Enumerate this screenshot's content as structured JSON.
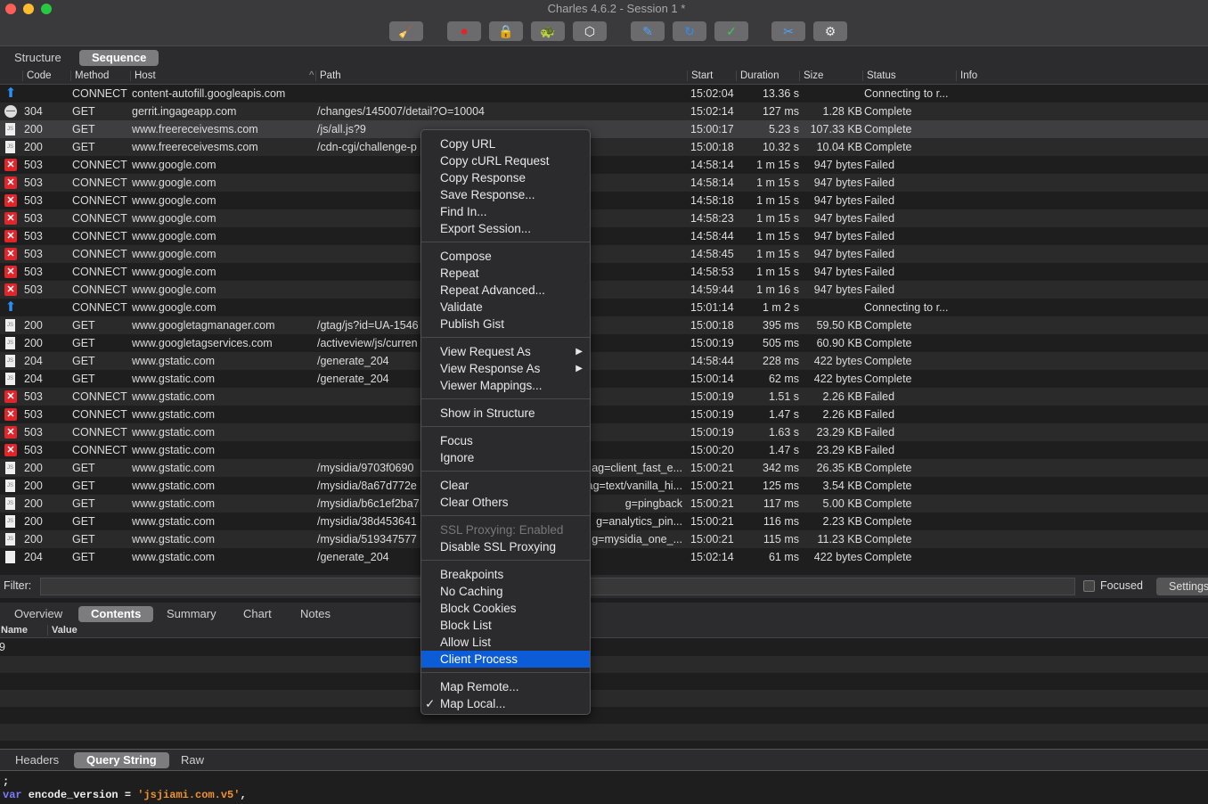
{
  "window": {
    "title": "Charles 4.6.2 - Session 1 *"
  },
  "toolbar": [
    {
      "icon": "broom-icon",
      "g": "🧹"
    },
    {
      "icon": "record-icon",
      "g": "⏺"
    },
    {
      "icon": "ssl-lock-icon",
      "g": "🔒"
    },
    {
      "icon": "throttle-turtle-icon",
      "g": "🐢"
    },
    {
      "icon": "breakpoint-hexagon-icon",
      "g": "⬡"
    },
    {
      "icon": "compose-pen-icon",
      "g": "✎"
    },
    {
      "icon": "repeat-icon",
      "g": "↻"
    },
    {
      "icon": "validate-check-icon",
      "g": "✓"
    },
    {
      "icon": "tools-icon",
      "g": "✂"
    },
    {
      "icon": "settings-gear-icon",
      "g": "⚙"
    }
  ],
  "view_tabs": [
    "Structure",
    "Sequence"
  ],
  "columns": [
    "Code",
    "Method",
    "Host",
    "Path",
    "Start",
    "Duration",
    "Size",
    "Status",
    "Info"
  ],
  "rows": [
    {
      "icon": "up",
      "code": "",
      "method": "CONNECT",
      "host": "content-autofill.googleapis.com",
      "path": "",
      "path_r": "",
      "start": "15:02:04",
      "duration": "13.36 s",
      "size": "",
      "status": "Connecting to r..."
    },
    {
      "icon": "blk",
      "code": "304",
      "method": "GET",
      "host": "gerrit.ingageapp.com",
      "path": "/changes/145007/detail?O=10004",
      "path_r": "",
      "start": "15:02:14",
      "duration": "127 ms",
      "size": "1.28 KB",
      "status": "Complete"
    },
    {
      "icon": "doc",
      "code": "200",
      "method": "GET",
      "host": "www.freereceivesms.com",
      "path": "/js/all.js?9",
      "path_r": "",
      "start": "15:00:17",
      "duration": "5.23 s",
      "size": "107.33 KB",
      "status": "Complete",
      "sel": true
    },
    {
      "icon": "doc",
      "code": "200",
      "method": "GET",
      "host": "www.freereceivesms.com",
      "path": "/cdn-cgi/challenge-p",
      "path_r": "",
      "start": "15:00:18",
      "duration": "10.32 s",
      "size": "10.04 KB",
      "status": "Complete"
    },
    {
      "icon": "x",
      "code": "503",
      "method": "CONNECT",
      "host": "www.google.com",
      "path": "",
      "path_r": "",
      "start": "14:58:14",
      "duration": "1 m 15 s",
      "size": "947 bytes",
      "status": "Failed"
    },
    {
      "icon": "x",
      "code": "503",
      "method": "CONNECT",
      "host": "www.google.com",
      "path": "",
      "path_r": "",
      "start": "14:58:14",
      "duration": "1 m 15 s",
      "size": "947 bytes",
      "status": "Failed"
    },
    {
      "icon": "x",
      "code": "503",
      "method": "CONNECT",
      "host": "www.google.com",
      "path": "",
      "path_r": "",
      "start": "14:58:18",
      "duration": "1 m 15 s",
      "size": "947 bytes",
      "status": "Failed"
    },
    {
      "icon": "x",
      "code": "503",
      "method": "CONNECT",
      "host": "www.google.com",
      "path": "",
      "path_r": "",
      "start": "14:58:23",
      "duration": "1 m 15 s",
      "size": "947 bytes",
      "status": "Failed"
    },
    {
      "icon": "x",
      "code": "503",
      "method": "CONNECT",
      "host": "www.google.com",
      "path": "",
      "path_r": "",
      "start": "14:58:44",
      "duration": "1 m 15 s",
      "size": "947 bytes",
      "status": "Failed"
    },
    {
      "icon": "x",
      "code": "503",
      "method": "CONNECT",
      "host": "www.google.com",
      "path": "",
      "path_r": "",
      "start": "14:58:45",
      "duration": "1 m 15 s",
      "size": "947 bytes",
      "status": "Failed"
    },
    {
      "icon": "x",
      "code": "503",
      "method": "CONNECT",
      "host": "www.google.com",
      "path": "",
      "path_r": "",
      "start": "14:58:53",
      "duration": "1 m 15 s",
      "size": "947 bytes",
      "status": "Failed"
    },
    {
      "icon": "x",
      "code": "503",
      "method": "CONNECT",
      "host": "www.google.com",
      "path": "",
      "path_r": "",
      "start": "14:59:44",
      "duration": "1 m 16 s",
      "size": "947 bytes",
      "status": "Failed"
    },
    {
      "icon": "up",
      "code": "",
      "method": "CONNECT",
      "host": "www.google.com",
      "path": "",
      "path_r": "",
      "start": "15:01:14",
      "duration": "1 m 2 s",
      "size": "",
      "status": "Connecting to r..."
    },
    {
      "icon": "doc",
      "code": "200",
      "method": "GET",
      "host": "www.googletagmanager.com",
      "path": "/gtag/js?id=UA-1546",
      "path_r": "",
      "start": "15:00:18",
      "duration": "395 ms",
      "size": "59.50 KB",
      "status": "Complete"
    },
    {
      "icon": "doc",
      "code": "200",
      "method": "GET",
      "host": "www.googletagservices.com",
      "path": "/activeview/js/curren",
      "path_r": "",
      "start": "15:00:19",
      "duration": "505 ms",
      "size": "60.90 KB",
      "status": "Complete"
    },
    {
      "icon": "doc",
      "code": "204",
      "method": "GET",
      "host": "www.gstatic.com",
      "path": "/generate_204",
      "path_r": "",
      "start": "14:58:44",
      "duration": "228 ms",
      "size": "422 bytes",
      "status": "Complete"
    },
    {
      "icon": "doc",
      "code": "204",
      "method": "GET",
      "host": "www.gstatic.com",
      "path": "/generate_204",
      "path_r": "",
      "start": "15:00:14",
      "duration": "62 ms",
      "size": "422 bytes",
      "status": "Complete"
    },
    {
      "icon": "x",
      "code": "503",
      "method": "CONNECT",
      "host": "www.gstatic.com",
      "path": "",
      "path_r": "",
      "start": "15:00:19",
      "duration": "1.51 s",
      "size": "2.26 KB",
      "status": "Failed"
    },
    {
      "icon": "x",
      "code": "503",
      "method": "CONNECT",
      "host": "www.gstatic.com",
      "path": "",
      "path_r": "",
      "start": "15:00:19",
      "duration": "1.47 s",
      "size": "2.26 KB",
      "status": "Failed"
    },
    {
      "icon": "x",
      "code": "503",
      "method": "CONNECT",
      "host": "www.gstatic.com",
      "path": "",
      "path_r": "",
      "start": "15:00:19",
      "duration": "1.63 s",
      "size": "23.29 KB",
      "status": "Failed"
    },
    {
      "icon": "x",
      "code": "503",
      "method": "CONNECT",
      "host": "www.gstatic.com",
      "path": "",
      "path_r": "",
      "start": "15:00:20",
      "duration": "1.47 s",
      "size": "23.29 KB",
      "status": "Failed"
    },
    {
      "icon": "doc",
      "code": "200",
      "method": "GET",
      "host": "www.gstatic.com",
      "path": "/mysidia/9703f0690",
      "path_r": "ag=client_fast_e...",
      "start": "15:00:21",
      "duration": "342 ms",
      "size": "26.35 KB",
      "status": "Complete"
    },
    {
      "icon": "doc",
      "code": "200",
      "method": "GET",
      "host": "www.gstatic.com",
      "path": "/mysidia/8a67d772e",
      "path_r": "ag=text/vanilla_hi...",
      "start": "15:00:21",
      "duration": "125 ms",
      "size": "3.54 KB",
      "status": "Complete"
    },
    {
      "icon": "doc",
      "code": "200",
      "method": "GET",
      "host": "www.gstatic.com",
      "path": "/mysidia/b6c1ef2ba7",
      "path_r": "g=pingback",
      "start": "15:00:21",
      "duration": "117 ms",
      "size": "5.00 KB",
      "status": "Complete"
    },
    {
      "icon": "doc",
      "code": "200",
      "method": "GET",
      "host": "www.gstatic.com",
      "path": "/mysidia/38d453641",
      "path_r": "g=analytics_pin...",
      "start": "15:00:21",
      "duration": "116 ms",
      "size": "2.23 KB",
      "status": "Complete"
    },
    {
      "icon": "doc",
      "code": "200",
      "method": "GET",
      "host": "www.gstatic.com",
      "path": "/mysidia/519347577",
      "path_r": "g=mysidia_one_...",
      "start": "15:00:21",
      "duration": "115 ms",
      "size": "11.23 KB",
      "status": "Complete"
    },
    {
      "icon": "blank",
      "code": "204",
      "method": "GET",
      "host": "www.gstatic.com",
      "path": "/generate_204",
      "path_r": "",
      "start": "15:02:14",
      "duration": "61 ms",
      "size": "422 bytes",
      "status": "Complete"
    }
  ],
  "filter": {
    "label": "Filter:",
    "value": "",
    "focused_label": "Focused",
    "settings_label": "Settings"
  },
  "detail_tabs": [
    "Overview",
    "Contents",
    "Summary",
    "Chart",
    "Notes"
  ],
  "nv": {
    "name": "Name",
    "value": "Value",
    "first": "9"
  },
  "body_tabs": [
    "Headers",
    "Query String",
    "Raw"
  ],
  "code": {
    "line1": ";",
    "kw": "var",
    "rest": " encode_version = ",
    "str": "'jsjiami.com.v5'",
    "end": ","
  },
  "menu": [
    [
      "Copy URL",
      "Copy cURL Request",
      "Copy Response",
      "Save Response...",
      "Find In...",
      "Export Session..."
    ],
    [
      "Compose",
      "Repeat",
      "Repeat Advanced...",
      "Validate",
      "Publish Gist"
    ],
    [
      "View Request As",
      "View Response As",
      "Viewer Mappings..."
    ],
    [
      "Show in Structure"
    ],
    [
      "Focus",
      "Ignore"
    ],
    [
      "Clear",
      "Clear Others"
    ],
    [
      "SSL Proxying: Enabled",
      "Disable SSL Proxying"
    ],
    [
      "Breakpoints",
      "No Caching",
      "Block Cookies",
      "Block List",
      "Allow List",
      "Client Process"
    ],
    [
      "Map Remote...",
      "Map Local..."
    ]
  ],
  "menu_state": {
    "highlighted": "Client Process",
    "checked": "Map Local...",
    "disabled": "SSL Proxying: Enabled",
    "submenus": [
      "View Request As",
      "View Response As"
    ]
  },
  "colors": {
    "accent": "#0b5cd6",
    "error": "#e0262b",
    "connect": "#2d8ff0"
  }
}
